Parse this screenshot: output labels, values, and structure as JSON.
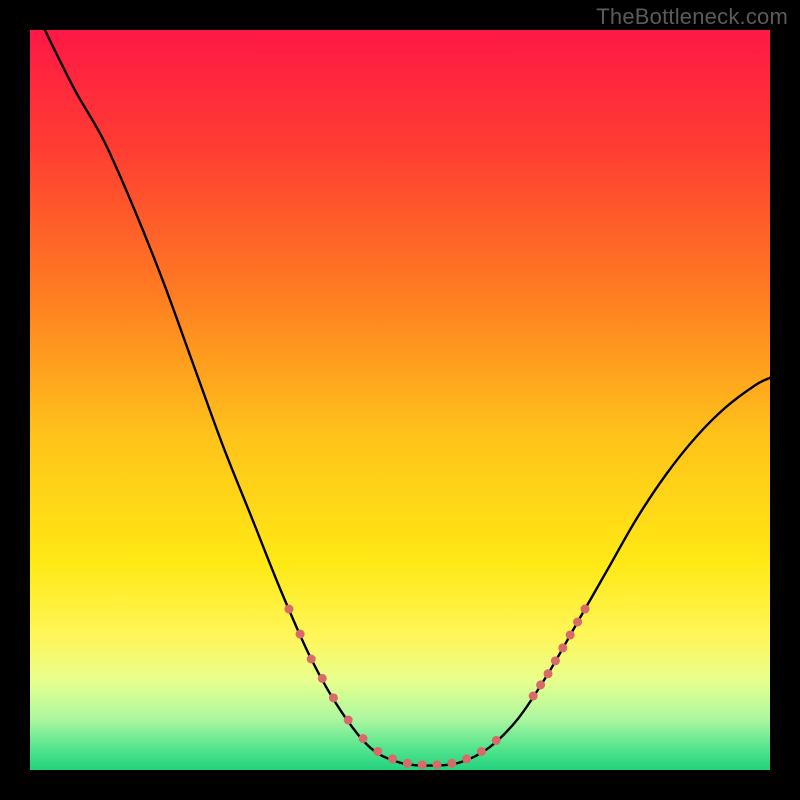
{
  "watermark": "TheBottleneck.com",
  "chart_data": {
    "type": "line",
    "title": "",
    "xlabel": "",
    "ylabel": "",
    "xlim": [
      0,
      100
    ],
    "ylim": [
      0,
      100
    ],
    "grid": false,
    "legend": false,
    "background_gradient_stops": [
      {
        "offset": 0.0,
        "color": "#ff1846"
      },
      {
        "offset": 0.15,
        "color": "#ff3a33"
      },
      {
        "offset": 0.35,
        "color": "#ff7a22"
      },
      {
        "offset": 0.55,
        "color": "#ffc31a"
      },
      {
        "offset": 0.72,
        "color": "#ffe915"
      },
      {
        "offset": 0.82,
        "color": "#fff65a"
      },
      {
        "offset": 0.88,
        "color": "#e7ff8e"
      },
      {
        "offset": 0.93,
        "color": "#aef7a0"
      },
      {
        "offset": 0.97,
        "color": "#55e58e"
      },
      {
        "offset": 1.0,
        "color": "#23d27e"
      }
    ],
    "curve": [
      {
        "x": 2,
        "y": 100
      },
      {
        "x": 6,
        "y": 92
      },
      {
        "x": 10,
        "y": 85
      },
      {
        "x": 14,
        "y": 76
      },
      {
        "x": 18,
        "y": 66
      },
      {
        "x": 22,
        "y": 55
      },
      {
        "x": 26,
        "y": 44
      },
      {
        "x": 30,
        "y": 34
      },
      {
        "x": 34,
        "y": 24
      },
      {
        "x": 38,
        "y": 15
      },
      {
        "x": 42,
        "y": 8
      },
      {
        "x": 46,
        "y": 3
      },
      {
        "x": 50,
        "y": 1
      },
      {
        "x": 54,
        "y": 0.6
      },
      {
        "x": 58,
        "y": 1
      },
      {
        "x": 62,
        "y": 3
      },
      {
        "x": 66,
        "y": 7
      },
      {
        "x": 70,
        "y": 13
      },
      {
        "x": 74,
        "y": 20
      },
      {
        "x": 78,
        "y": 27
      },
      {
        "x": 82,
        "y": 34
      },
      {
        "x": 86,
        "y": 40
      },
      {
        "x": 90,
        "y": 45
      },
      {
        "x": 94,
        "y": 49
      },
      {
        "x": 98,
        "y": 52
      },
      {
        "x": 100,
        "y": 53
      }
    ],
    "highlight_dots_x": [
      35,
      36.5,
      38,
      39.5,
      41,
      43,
      45,
      47,
      49,
      51,
      53,
      55,
      57,
      59,
      61,
      63,
      68,
      69,
      70,
      71,
      72,
      73,
      74,
      75
    ],
    "highlight_dot_style": {
      "radius": 4.5,
      "fill": "#d86a68",
      "stroke": "none"
    },
    "curve_style": {
      "stroke": "#000000",
      "width": 2.4
    }
  }
}
